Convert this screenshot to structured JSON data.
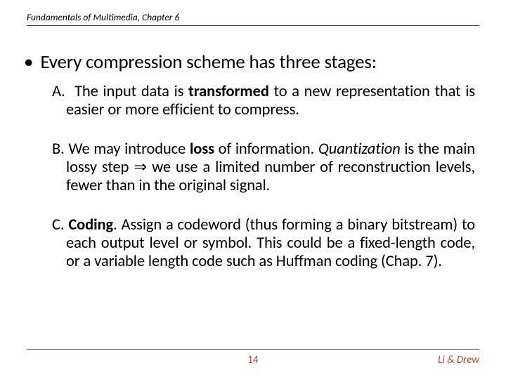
{
  "header": {
    "title": "Fundamentals of Multimedia, Chapter 6"
  },
  "main": {
    "bullet": "•",
    "text": "Every compression scheme has three stages:",
    "items": {
      "a_label": "A.",
      "a_pre": "The input data is ",
      "a_bold": "transformed",
      "a_post": " to a new representation that is easier or more efficient to compress.",
      "b_label": "B.",
      "b_t1": " We may introduce ",
      "b_b1": "loss",
      "b_t2": " of information. ",
      "b_i1": "Quantization",
      "b_t3": " is the main lossy step ⇒ we use a limited number of reconstruction levels, fewer than in the original signal.",
      "c_label": "C.",
      "c_b1": "Coding",
      "c_t1": ". Assign a codeword (thus forming a binary bitstream) to each output level or symbol. This could be a fixed-length code, or a variable length code such as Huffman coding (Chap. 7)."
    }
  },
  "footer": {
    "page": "14",
    "authors": "Li & Drew"
  }
}
